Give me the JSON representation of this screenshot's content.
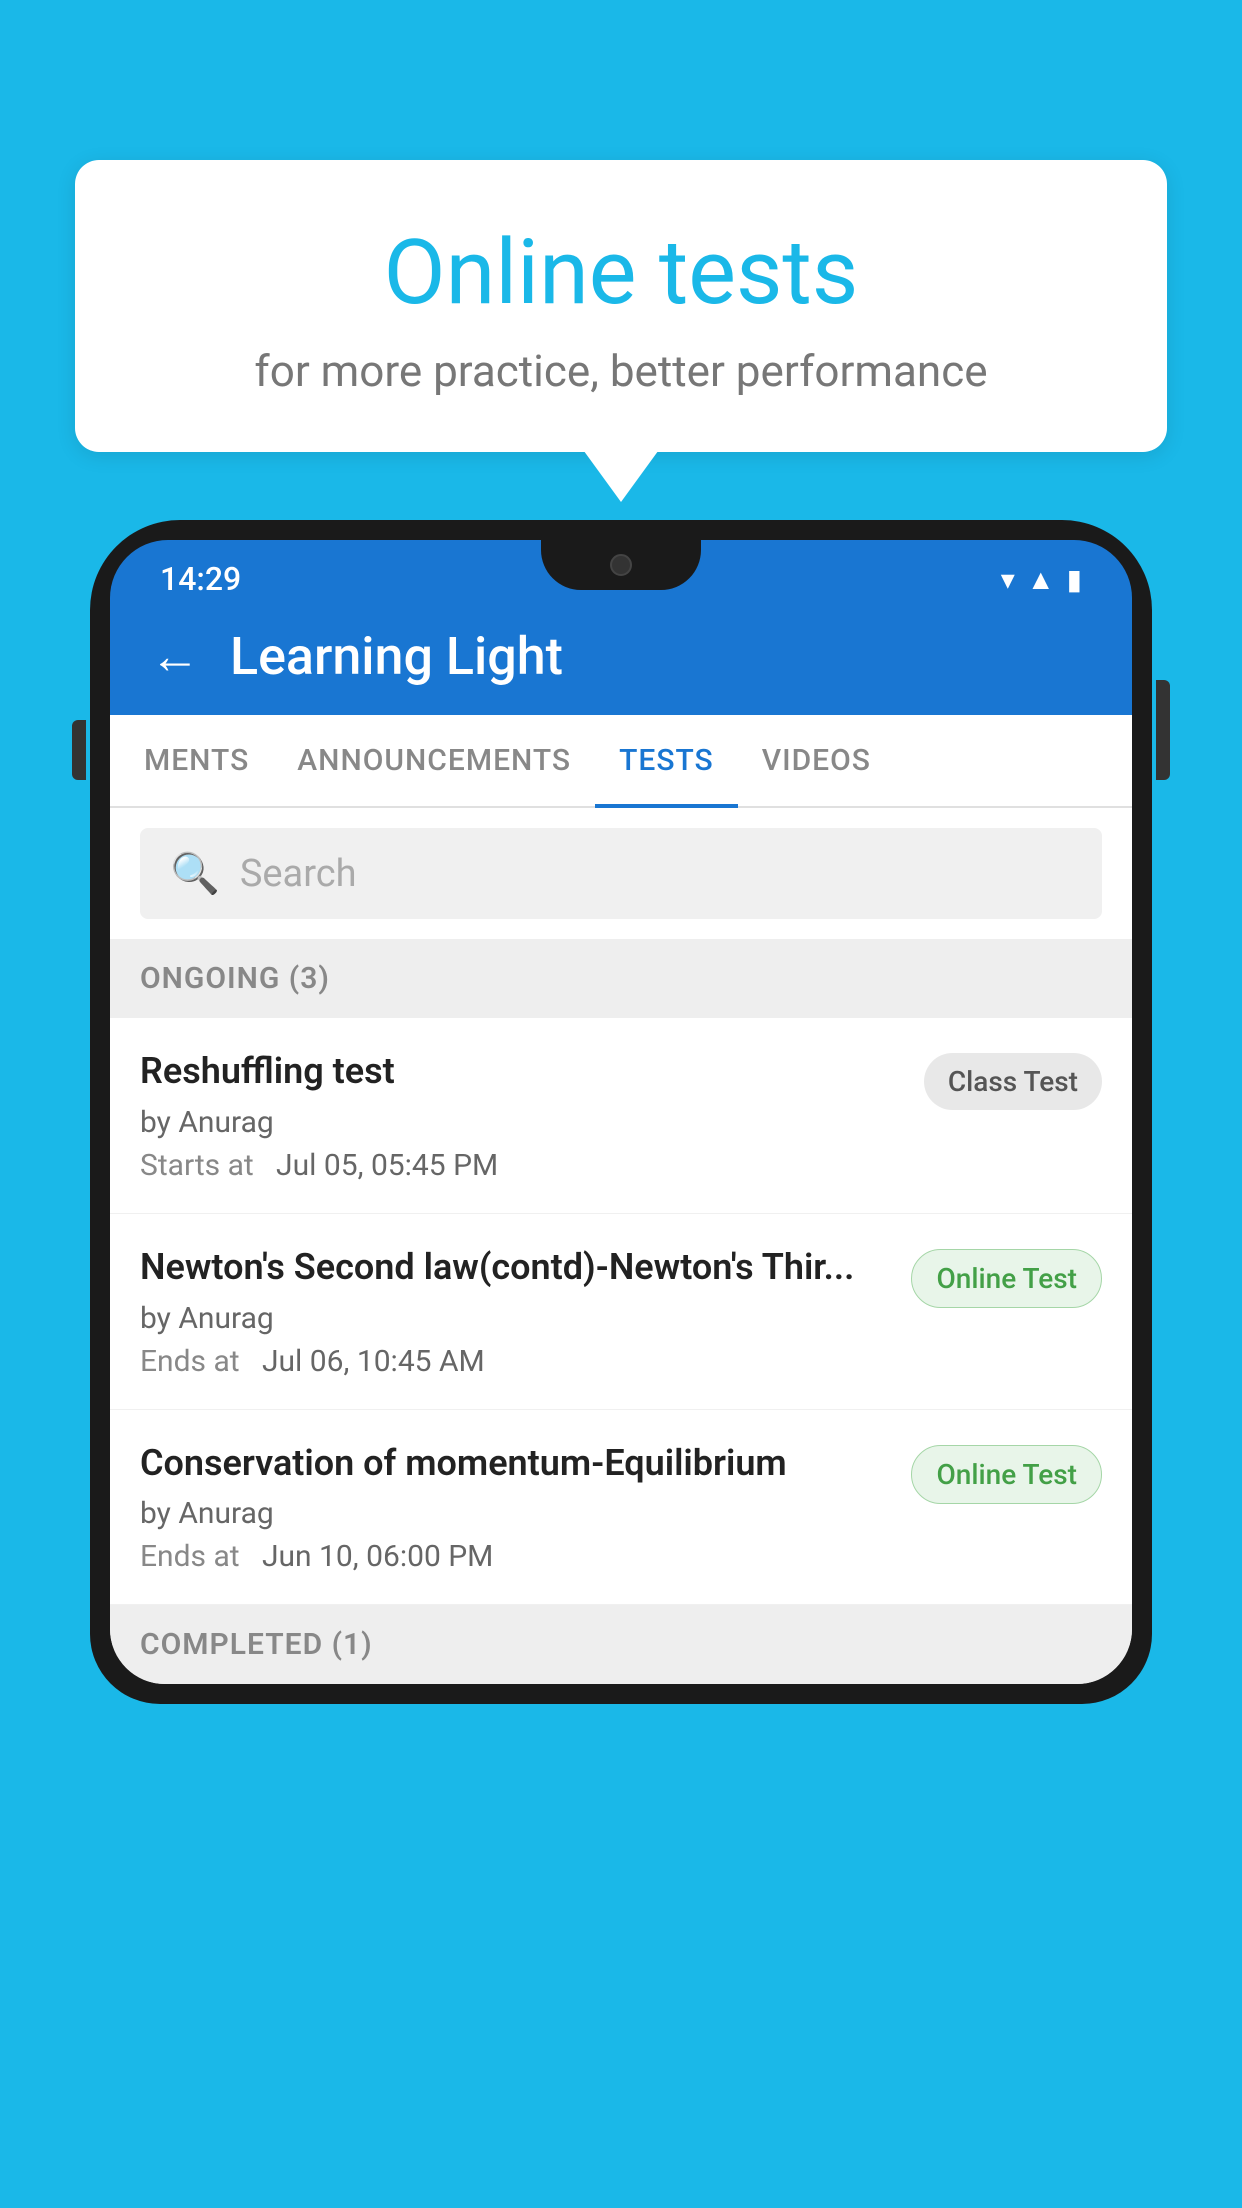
{
  "background_color": "#1ab8e8",
  "bubble": {
    "title": "Online tests",
    "subtitle": "for more practice, better performance"
  },
  "phone": {
    "status_bar": {
      "time": "14:29",
      "icons": [
        "wifi",
        "signal",
        "battery"
      ]
    },
    "header": {
      "back_label": "←",
      "title": "Learning Light"
    },
    "tabs": [
      {
        "label": "MENTS",
        "active": false
      },
      {
        "label": "ANNOUNCEMENTS",
        "active": false
      },
      {
        "label": "TESTS",
        "active": true
      },
      {
        "label": "VIDEOS",
        "active": false
      }
    ],
    "search": {
      "placeholder": "Search"
    },
    "ongoing_section": {
      "label": "ONGOING (3)"
    },
    "tests": [
      {
        "name": "Reshuffling test",
        "author": "by Anurag",
        "time_label": "Starts at",
        "time_value": "Jul 05, 05:45 PM",
        "badge": "Class Test",
        "badge_type": "class"
      },
      {
        "name": "Newton's Second law(contd)-Newton's Thir...",
        "author": "by Anurag",
        "time_label": "Ends at",
        "time_value": "Jul 06, 10:45 AM",
        "badge": "Online Test",
        "badge_type": "online"
      },
      {
        "name": "Conservation of momentum-Equilibrium",
        "author": "by Anurag",
        "time_label": "Ends at",
        "time_value": "Jun 10, 06:00 PM",
        "badge": "Online Test",
        "badge_type": "online"
      }
    ],
    "completed_section": {
      "label": "COMPLETED (1)"
    }
  }
}
